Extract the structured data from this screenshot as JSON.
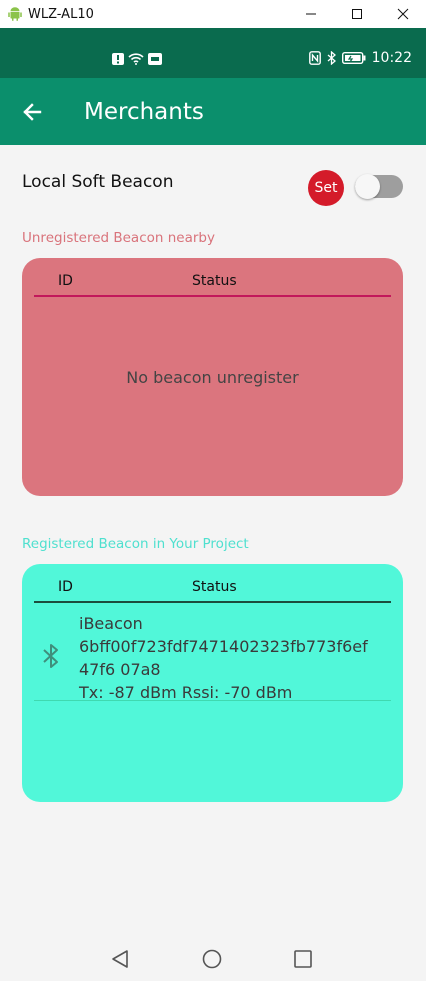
{
  "window": {
    "title": "WLZ-AL10",
    "controls": [
      "minimize",
      "maximize",
      "close"
    ]
  },
  "statusbar": {
    "time": "10:22",
    "colors": {
      "bg": "#0a6b4e"
    }
  },
  "appbar": {
    "title": "Merchants",
    "back_icon": "arrow-left-icon",
    "colors": {
      "bg": "#0b8f6c"
    }
  },
  "local": {
    "label": "Local Soft Beacon",
    "set_label": "Set",
    "toggle_on": false
  },
  "unregistered": {
    "section_label": "Unregistered Beacon nearby",
    "col_id": "ID",
    "col_status": "Status",
    "empty_text": "No beacon unregister",
    "colors": {
      "label": "#d9737b",
      "card": "#db757e",
      "line": "#c2185b"
    }
  },
  "registered": {
    "section_label": "Registered Beacon in Your Project",
    "col_id": "ID",
    "col_status": "Status",
    "colors": {
      "label": "#4fe0cf",
      "card": "#51f7d9",
      "line": "#1b4d3e"
    },
    "items": [
      {
        "type": "iBeacon",
        "uuid_line1": "6bff00f723fdf7471402323fb773f6ef",
        "uuid_line2": "47f6  07a8",
        "signal": "Tx: -87 dBm  Rssi: -70 dBm"
      }
    ]
  },
  "navbar": {
    "buttons": [
      "back-triangle-icon",
      "home-circle-icon",
      "recents-square-icon"
    ]
  }
}
